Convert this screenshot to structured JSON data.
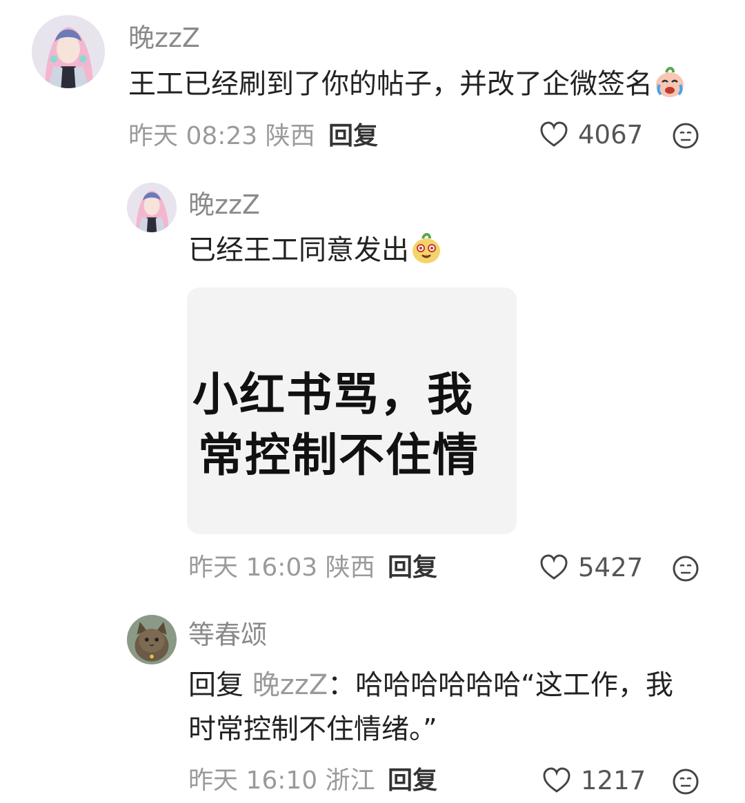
{
  "comments": [
    {
      "username": "晚zzZ",
      "text": "王工已经刷到了你的帖子，并改了企微签名",
      "emoji": "crying-face-emoji",
      "time": "昨天 08:23 陕西",
      "reply_label": "回复",
      "likes": "4067"
    },
    {
      "username": "晚zzZ",
      "text": "已经王工同意发出",
      "emoji": "smile-face-emoji",
      "image_lines": [
        "小红书骂，我",
        "常控制不住情"
      ],
      "time": "昨天 16:03 陕西",
      "reply_label": "回复",
      "likes": "5427"
    },
    {
      "username": "等春颂",
      "reply_prefix": "回复",
      "mention": "晚zzZ",
      "text_line1": "：哈哈哈哈哈哈“这工作，我",
      "text_line2": "时常控制不住情绪。”",
      "time": "昨天 16:10 浙江",
      "reply_label": "回复",
      "likes": "1217"
    }
  ]
}
